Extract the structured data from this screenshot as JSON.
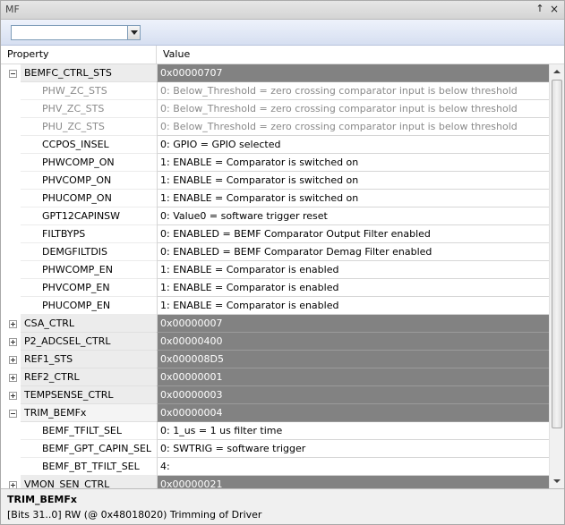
{
  "window": {
    "title": "MF",
    "pin_glyph": "↑",
    "close_glyph": "×"
  },
  "toolbar": {
    "combo_value": ""
  },
  "header": {
    "property": "Property",
    "value": "Value"
  },
  "rows": [
    {
      "kind": "group",
      "expanded": true,
      "name": "BEMFC_CTRL_STS",
      "value": "0x00000707"
    },
    {
      "kind": "child",
      "disabled": true,
      "name": "PHW_ZC_STS",
      "value": "0: Below_Threshold = zero crossing comparator input is below threshold"
    },
    {
      "kind": "child",
      "disabled": true,
      "name": "PHV_ZC_STS",
      "value": "0: Below_Threshold = zero crossing comparator input is below threshold"
    },
    {
      "kind": "child",
      "disabled": true,
      "name": "PHU_ZC_STS",
      "value": "0: Below_Threshold = zero crossing comparator input is below threshold"
    },
    {
      "kind": "child",
      "disabled": false,
      "name": "CCPOS_INSEL",
      "value": "0: GPIO = GPIO selected"
    },
    {
      "kind": "child",
      "disabled": false,
      "name": "PHWCOMP_ON",
      "value": "1: ENABLE = Comparator is switched on"
    },
    {
      "kind": "child",
      "disabled": false,
      "name": "PHVCOMP_ON",
      "value": "1: ENABLE = Comparator is switched on"
    },
    {
      "kind": "child",
      "disabled": false,
      "name": "PHUCOMP_ON",
      "value": "1: ENABLE = Comparator is switched on"
    },
    {
      "kind": "child",
      "disabled": false,
      "name": "GPT12CAPINSW",
      "value": "0: Value0 = software trigger reset"
    },
    {
      "kind": "child",
      "disabled": false,
      "name": "FILTBYPS",
      "value": "0: ENABLED = BEMF Comparator Output Filter enabled"
    },
    {
      "kind": "child",
      "disabled": false,
      "name": "DEMGFILTDIS",
      "value": "0: ENABLED = BEMF Comparator Demag Filter enabled"
    },
    {
      "kind": "child",
      "disabled": false,
      "name": "PHWCOMP_EN",
      "value": "1: ENABLE = Comparator is enabled"
    },
    {
      "kind": "child",
      "disabled": false,
      "name": "PHVCOMP_EN",
      "value": "1: ENABLE = Comparator is enabled"
    },
    {
      "kind": "child",
      "disabled": false,
      "name": "PHUCOMP_EN",
      "value": "1: ENABLE = Comparator is enabled"
    },
    {
      "kind": "group",
      "expanded": false,
      "name": "CSA_CTRL",
      "value": "0x00000007"
    },
    {
      "kind": "group",
      "expanded": false,
      "name": "P2_ADCSEL_CTRL",
      "value": "0x00000400"
    },
    {
      "kind": "group",
      "expanded": false,
      "name": "REF1_STS",
      "value": "0x000008D5"
    },
    {
      "kind": "group",
      "expanded": false,
      "name": "REF2_CTRL",
      "value": "0x00000001"
    },
    {
      "kind": "group",
      "expanded": false,
      "name": "TEMPSENSE_CTRL",
      "value": "0x00000003"
    },
    {
      "kind": "group",
      "expanded": true,
      "name": "TRIM_BEMFx",
      "value": "0x00000004",
      "selected": true
    },
    {
      "kind": "child",
      "disabled": false,
      "name": "BEMF_TFILT_SEL",
      "value": "0: 1_us = 1 us filter time"
    },
    {
      "kind": "child",
      "disabled": false,
      "name": "BEMF_GPT_CAPIN_SEL",
      "value": "0: SWTRIG = software trigger"
    },
    {
      "kind": "child",
      "disabled": false,
      "name": "BEMF_BT_TFILT_SEL",
      "value": "4:"
    },
    {
      "kind": "group",
      "expanded": false,
      "name": "VMON_SEN_CTRL",
      "value": "0x00000021"
    }
  ],
  "description": {
    "title": "TRIM_BEMFx",
    "text": "[Bits 31..0] RW (@ 0x48018020) Trimming of Driver"
  },
  "colors": {
    "group_value_bg": "#828282",
    "toolbar_bg": "#d6dff1",
    "disabled_text": "#8a8a8a"
  },
  "icons": {
    "expand": "plus-box-icon",
    "collapse": "minus-box-icon",
    "dropdown": "chevron-down-icon"
  }
}
